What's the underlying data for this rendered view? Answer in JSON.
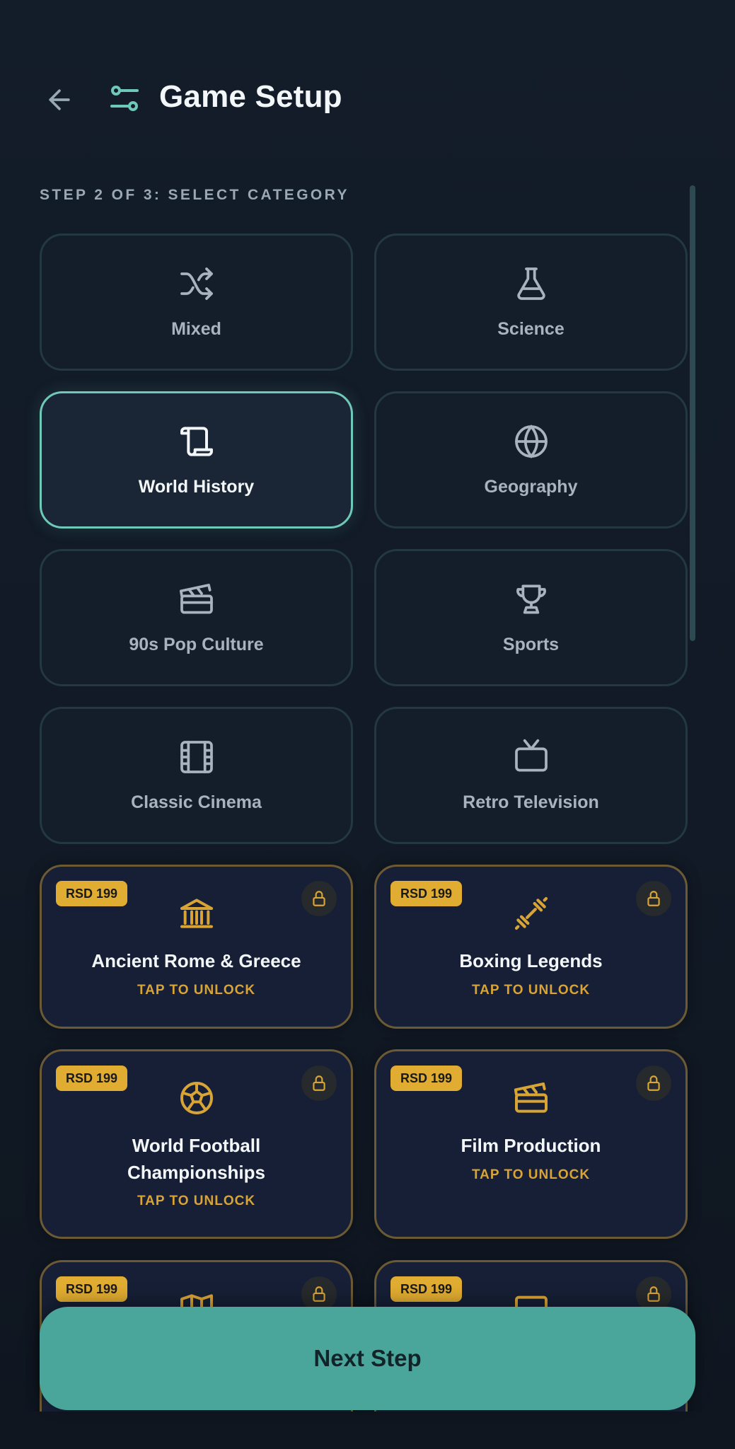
{
  "header": {
    "title": "Game Setup",
    "back_icon": "arrow-left-icon",
    "title_icon": "sliders-icon"
  },
  "step": {
    "label": "STEP 2 OF 3: SELECT CATEGORY"
  },
  "colors": {
    "accent": "#6fc9b8",
    "button": "#4aa69a",
    "gold": "#e0ac31",
    "background": "#131c29"
  },
  "free_categories": [
    {
      "label": "Mixed",
      "icon": "shuffle-icon",
      "selected": false
    },
    {
      "label": "Science",
      "icon": "flask-icon",
      "selected": false
    },
    {
      "label": "World History",
      "icon": "scroll-icon",
      "selected": true
    },
    {
      "label": "Geography",
      "icon": "globe-icon",
      "selected": false
    },
    {
      "label": "90s Pop Culture",
      "icon": "clapperboard-icon",
      "selected": false
    },
    {
      "label": "Sports",
      "icon": "trophy-icon",
      "selected": false
    },
    {
      "label": "Classic Cinema",
      "icon": "film-icon",
      "selected": false
    },
    {
      "label": "Retro Television",
      "icon": "tv-icon",
      "selected": false
    }
  ],
  "premium_categories": [
    {
      "price": "RSD 199",
      "label": "Ancient Rome & Greece",
      "unlock": "TAP TO UNLOCK",
      "icon": "landmark-icon"
    },
    {
      "price": "RSD 199",
      "label": "Boxing Legends",
      "unlock": "TAP TO UNLOCK",
      "icon": "dumbbell-icon"
    },
    {
      "price": "RSD 199",
      "label": "World Football Championships",
      "label_line1": "World Football",
      "label_line2": "Championships",
      "unlock": "TAP TO UNLOCK",
      "icon": "soccer-ball-icon"
    },
    {
      "price": "RSD 199",
      "label": "Film Production",
      "unlock": "TAP TO UNLOCK",
      "icon": "clapperboard-icon"
    },
    {
      "price": "RSD 199",
      "icon": "map-icon"
    },
    {
      "price": "RSD 199",
      "icon": "monitor-icon"
    }
  ],
  "footer": {
    "next_label": "Next Step"
  }
}
